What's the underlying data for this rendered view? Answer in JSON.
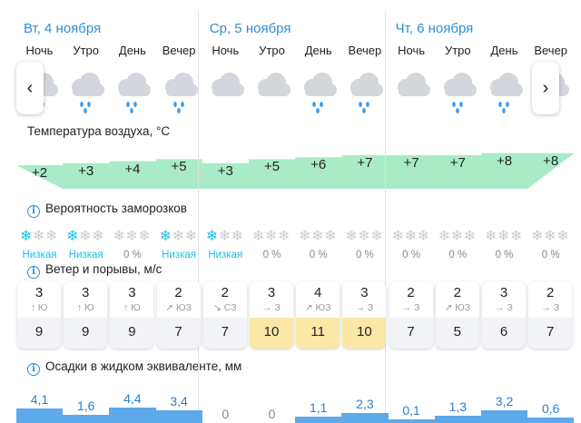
{
  "days": [
    {
      "label": "Вт, 4 ноября",
      "periods": [
        {
          "name": "Ночь",
          "icon": "cloud-rain-icon",
          "temp": "+2",
          "frost_flakes": 1,
          "frost": "Низкая",
          "wind": "3",
          "wind_dir": "↑ Ю",
          "gust": "9",
          "gust_warn": false,
          "precip": "4,1",
          "precip_mm": 4.1
        },
        {
          "name": "Утро",
          "icon": "cloud-rain-icon",
          "temp": "+3",
          "frost_flakes": 1,
          "frost": "Низкая",
          "wind": "3",
          "wind_dir": "↑ Ю",
          "gust": "9",
          "gust_warn": false,
          "precip": "1,6",
          "precip_mm": 1.6
        },
        {
          "name": "День",
          "icon": "cloud-rain-icon",
          "temp": "+4",
          "frost_flakes": 0,
          "frost": "0 %",
          "wind": "3",
          "wind_dir": "↑ Ю",
          "gust": "9",
          "gust_warn": false,
          "precip": "4,4",
          "precip_mm": 4.4
        },
        {
          "name": "Вечер",
          "icon": "cloud-rain-icon",
          "temp": "+5",
          "frost_flakes": 1,
          "frost": "Низкая",
          "wind": "2",
          "wind_dir": "↗ ЮЗ",
          "gust": "7",
          "gust_warn": false,
          "precip": "3,4",
          "precip_mm": 3.4
        }
      ]
    },
    {
      "label": "Ср, 5 ноября",
      "periods": [
        {
          "name": "Ночь",
          "icon": "cloud-icon",
          "temp": "+3",
          "frost_flakes": 1,
          "frost": "Низкая",
          "wind": "2",
          "wind_dir": "↘ СЗ",
          "gust": "7",
          "gust_warn": false,
          "precip": "0",
          "precip_mm": 0
        },
        {
          "name": "Утро",
          "icon": "cloud-icon",
          "temp": "+5",
          "frost_flakes": 0,
          "frost": "0 %",
          "wind": "3",
          "wind_dir": "→ З",
          "gust": "10",
          "gust_warn": true,
          "precip": "0",
          "precip_mm": 0
        },
        {
          "name": "День",
          "icon": "cloud-rain-icon",
          "temp": "+6",
          "frost_flakes": 0,
          "frost": "0 %",
          "wind": "4",
          "wind_dir": "↗ ЮЗ",
          "gust": "11",
          "gust_warn": true,
          "precip": "1,1",
          "precip_mm": 1.1
        },
        {
          "name": "Вечер",
          "icon": "cloud-rain-icon",
          "temp": "+7",
          "frost_flakes": 0,
          "frost": "0 %",
          "wind": "3",
          "wind_dir": "→ З",
          "gust": "10",
          "gust_warn": true,
          "precip": "2,3",
          "precip_mm": 2.3
        }
      ]
    },
    {
      "label": "Чт, 6 ноября",
      "periods": [
        {
          "name": "Ночь",
          "icon": "cloud-icon",
          "temp": "+7",
          "frost_flakes": 0,
          "frost": "0 %",
          "wind": "2",
          "wind_dir": "→ З",
          "gust": "7",
          "gust_warn": false,
          "precip": "0,1",
          "precip_mm": 0.1
        },
        {
          "name": "Утро",
          "icon": "cloud-rain-icon",
          "temp": "+7",
          "frost_flakes": 0,
          "frost": "0 %",
          "wind": "2",
          "wind_dir": "↗ ЮЗ",
          "gust": "5",
          "gust_warn": false,
          "precip": "1,3",
          "precip_mm": 1.3
        },
        {
          "name": "День",
          "icon": "cloud-rain-icon",
          "temp": "+8",
          "frost_flakes": 0,
          "frost": "0 %",
          "wind": "3",
          "wind_dir": "→ З",
          "gust": "6",
          "gust_warn": false,
          "precip": "3,2",
          "precip_mm": 3.2
        },
        {
          "name": "Вечер",
          "icon": "cloud-rain-icon",
          "temp": "+8",
          "frost_flakes": 0,
          "frost": "0 %",
          "wind": "2",
          "wind_dir": "→ З",
          "gust": "7",
          "gust_warn": false,
          "precip": "0,6",
          "precip_mm": 0.6
        }
      ]
    }
  ],
  "sections": {
    "temperature": "Температура воздуха, °C",
    "frost": "Вероятность заморозков",
    "wind": "Ветер и порывы, м/с",
    "precip": "Осадки в жидком эквиваленте, мм"
  },
  "icons": {
    "info": "info-icon",
    "prev": "chevron-left-icon",
    "next": "chevron-right-icon",
    "snowflake": "snowflake-icon"
  },
  "colors": {
    "accent": "#2d8fd5",
    "temp_band": "#9ae7bd",
    "frost_active": "#1fc0e6",
    "frost_inactive": "#c9cdd2",
    "precip": "#5da9ea",
    "gust_warn": "#fbe7a6",
    "wind_bottom": "#f1f3f6"
  }
}
